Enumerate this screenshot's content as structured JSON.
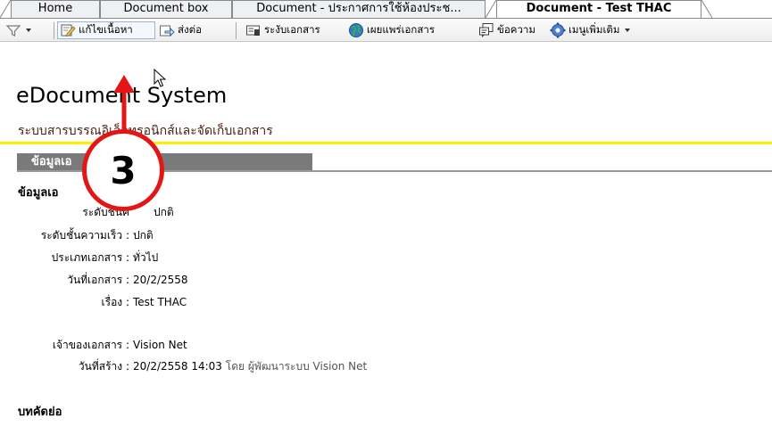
{
  "tabs": [
    {
      "label": "Home"
    },
    {
      "label": "Document box"
    },
    {
      "label": "Document - ประกาศการใช้ห้องประช..."
    },
    {
      "label": "Document - Test THAC"
    }
  ],
  "toolbar": {
    "filter_icon": "filter-icon",
    "edit_label": "แก้ไขเนื้อหา",
    "forward_label": "ส่งต่อ",
    "suspend_label": "ระงับเอกสาร",
    "publish_label": "เผยแพร่เอกสาร",
    "message_label": "ข้อความ",
    "more_label": "เมนูเพิ่มเติม"
  },
  "page": {
    "title": "eDocument System",
    "subtitle": "ระบบสารบรรณอิเล็กทรอนิกส์และจัดเก็บเอกสาร",
    "section_title": "ข้อมูลเอ",
    "group_heading": "ข้อมูลเอ",
    "abstract_heading": "บทคัดย่อ"
  },
  "fields": {
    "secrecy": {
      "label": "ระดับชั้นค",
      "value": "ปกติ"
    },
    "urgency": {
      "label": "ระดับชั้นความเร็ว :",
      "value": "ปกติ"
    },
    "doc_type": {
      "label": "ประเภทเอกสาร :",
      "value": "ทั่วไป"
    },
    "doc_date": {
      "label": "วันที่เอกสาร :",
      "value": "20/2/2558"
    },
    "subject": {
      "label": "เรื่อง :",
      "value": "Test THAC"
    },
    "owner": {
      "label": "เจ้าของเอกสาร :",
      "value": "Vision Net"
    },
    "created": {
      "label": "วันที่สร้าง :",
      "value": "20/2/2558 14:03",
      "by": "โดย",
      "creator": "ผู้พัฒนาระบบ Vision Net"
    }
  },
  "annotation": {
    "step_number": "3",
    "color": "#e41515"
  },
  "colors": {
    "yellow_rule": "#ffee00",
    "section_bar": "#7a7a7a",
    "subtitle": "#4a1e10"
  }
}
